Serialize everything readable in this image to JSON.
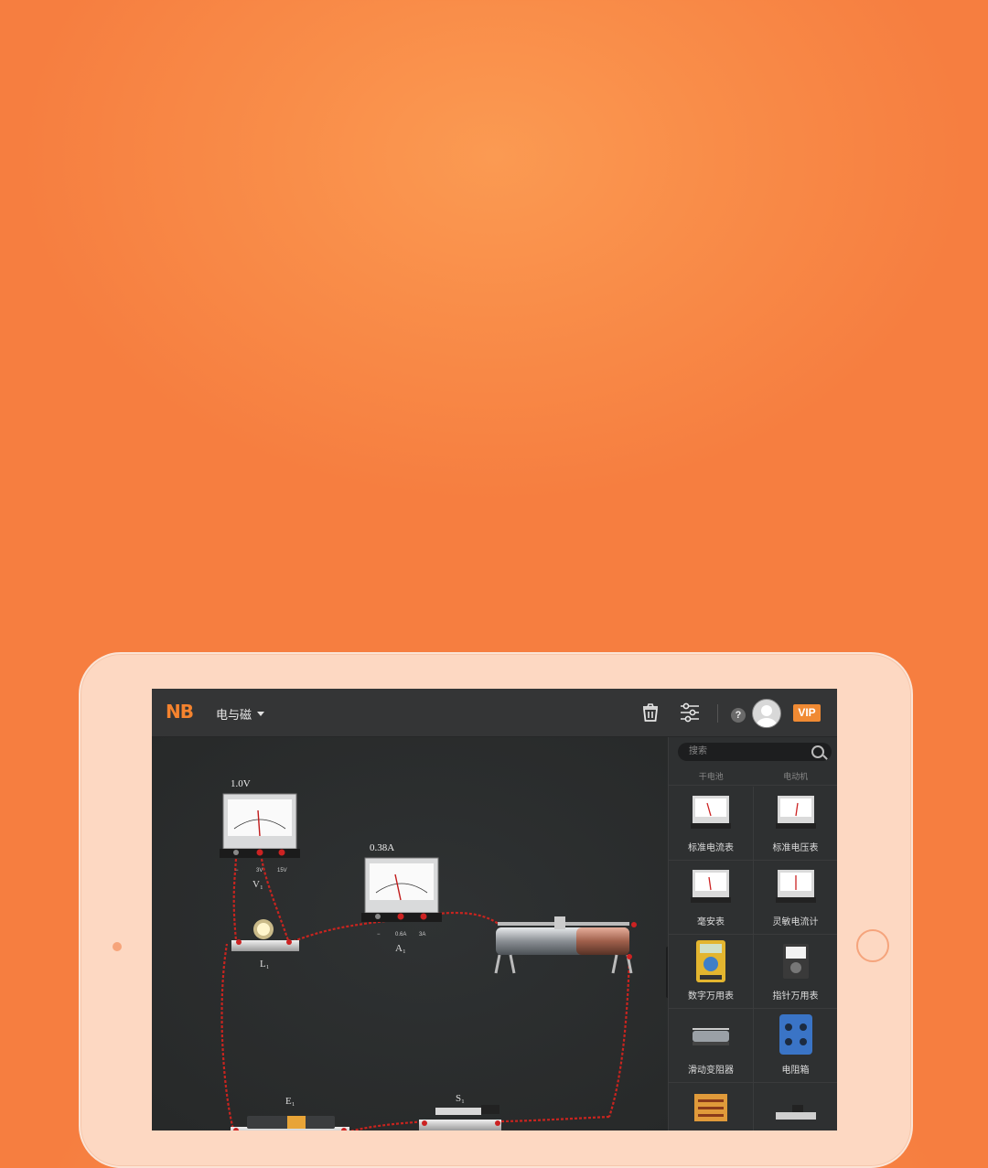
{
  "app": {
    "logo": "NB",
    "category": "电与磁"
  },
  "toolbar": {
    "icons": [
      "trash-icon",
      "sliders-icon"
    ],
    "help_label": "?",
    "vip_label": "VIP"
  },
  "panel": {
    "search_placeholder": "搜索",
    "tabs": [
      "干电池",
      "电动机"
    ],
    "items": [
      {
        "label": "标准电流表",
        "icon": "ammeter-icon"
      },
      {
        "label": "标准电压表",
        "icon": "voltmeter-icon"
      },
      {
        "label": "毫安表",
        "icon": "milliammeter-icon"
      },
      {
        "label": "灵敏电流计",
        "icon": "galvanometer-icon"
      },
      {
        "label": "数字万用表",
        "icon": "digital-multimeter-icon"
      },
      {
        "label": "指针万用表",
        "icon": "analog-multimeter-icon"
      },
      {
        "label": "滑动变阻器",
        "icon": "rheostat-icon"
      },
      {
        "label": "电阻箱",
        "icon": "resistance-box-icon"
      }
    ]
  },
  "circuit": {
    "voltmeter": {
      "reading": "1.0V",
      "label": "V₁",
      "terminals": [
        "−",
        "3V",
        "15V"
      ]
    },
    "ammeter": {
      "reading": "0.38A",
      "label": "A₁",
      "terminals": [
        "−",
        "0.6A",
        "3A"
      ]
    },
    "bulb": {
      "label": "L₁"
    },
    "battery": {
      "label": "E₁"
    },
    "switch": {
      "label": "S₁"
    },
    "wire_color": "#c9241f"
  }
}
